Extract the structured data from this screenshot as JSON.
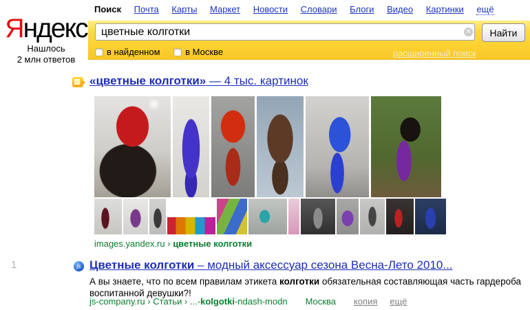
{
  "nav": {
    "items": [
      {
        "label": "Поиск",
        "active": true
      },
      {
        "label": "Почта"
      },
      {
        "label": "Карты"
      },
      {
        "label": "Маркет"
      },
      {
        "label": "Новости"
      },
      {
        "label": "Словари"
      },
      {
        "label": "Блоги"
      },
      {
        "label": "Видео"
      },
      {
        "label": "Картинки"
      },
      {
        "label": "ещё",
        "dotted": true
      }
    ]
  },
  "logo": {
    "first_letter": "Я",
    "rest": "ндекс"
  },
  "results_count": {
    "line1": "Нашлось",
    "line2": "2 млн ответов"
  },
  "search": {
    "query": "цветные колготки",
    "button_label": "Найти",
    "clear_glyph": "✕",
    "checkbox_in_found": "в найденном",
    "checkbox_in_moscow": "в Москве",
    "advanced_link": "расширенный поиск"
  },
  "image_result": {
    "title_bold": "«цветные колготки»",
    "title_rest": " — 4 тыс. картинок",
    "url_site": "images.yandex.ru",
    "url_sep": " › ",
    "url_path": "цветные колготки"
  },
  "web_result": {
    "number": "1",
    "favicon_text": "js",
    "title_bold": "Цветные колготки",
    "title_rest": " – модный аксессуар сезона Весна-Лето 2010...",
    "snippet_pre": "А вы знаете, что по всем правилам этикета ",
    "snippet_bold": "колготки",
    "snippet_post": " обязательная составляющая часть гардероба воспитанной девушки?!",
    "url_site": "js-company.ru",
    "url_sep1": " › ",
    "url_mid": "Статьи",
    "url_sep2": " › ",
    "url_path_pre": "...-",
    "url_path_bold": "kolgotki",
    "url_path_post": "-ndash-modn",
    "region": "Москва",
    "copy_link": "копия",
    "more_link": "ещё"
  },
  "colors": {
    "yandex_yellow": "#fbcf2f",
    "link_blue": "#1c2db8",
    "url_green": "#0a7d30",
    "logo_red": "#e30b13"
  }
}
